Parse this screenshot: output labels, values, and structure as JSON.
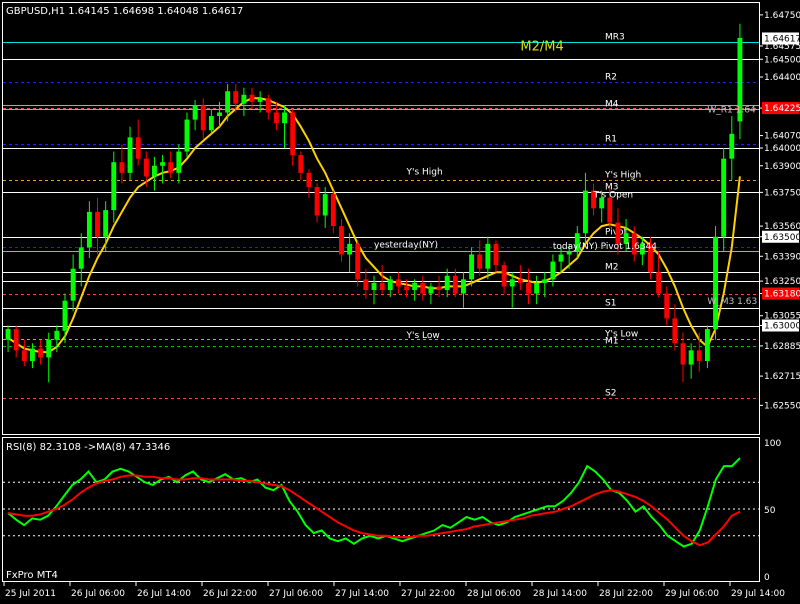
{
  "chart_data": [
    {
      "type": "candlestick",
      "title": "GBPUSD,H1  1.64145 1.64698 1.64048 1.64617",
      "ylim": [
        1.624,
        1.648
      ],
      "x": [
        "25 Jul 2011",
        "26 Jul 06:00",
        "26 Jul 14:00",
        "26 Jul 22:00",
        "27 Jul 06:00",
        "27 Jul 14:00",
        "27 Jul 22:00",
        "28 Jul 06:00",
        "28 Jul 14:00",
        "28 Jul 22:00",
        "29 Jul 06:00",
        "29 Jul 14:00"
      ],
      "price_ticks": [
        "1.64750",
        "1.64575",
        "1.64500",
        "1.64400",
        "1.64225",
        "1.64070",
        "1.64000",
        "1.63900",
        "1.63750",
        "1.63560",
        "1.63500",
        "1.63390",
        "1.63250",
        "1.63180",
        "1.63055",
        "1.63000",
        "1.62885",
        "1.62715",
        "1.62550"
      ],
      "price_ticks_v": [
        1.6475,
        1.64575,
        1.645,
        1.644,
        1.64225,
        1.6407,
        1.64,
        1.639,
        1.6375,
        1.6356,
        1.635,
        1.6339,
        1.6325,
        1.6318,
        1.63055,
        1.63,
        1.62885,
        1.62715,
        1.6255
      ],
      "highlight_ticks": [
        {
          "label": "1.64617",
          "v": 1.64617,
          "bg": "#ffffff",
          "fg": "#000000"
        },
        {
          "label": "1.64225",
          "v": 1.64225,
          "bg": "#ff0000",
          "fg": "#ffffff"
        },
        {
          "label": "1.63500",
          "v": 1.635,
          "bg": "#ffffff",
          "fg": "#000000"
        },
        {
          "label": "1.63180",
          "v": 1.6318,
          "bg": "#ff0000",
          "fg": "#ffffff"
        },
        {
          "label": "1.63000",
          "v": 1.63,
          "bg": "#ffffff",
          "fg": "#000000"
        }
      ],
      "levels": [
        {
          "label": "MR3",
          "v": 1.646,
          "color": "#00e0e0",
          "style": "solid"
        },
        {
          "label": "",
          "v": 1.645,
          "color": "#ffffff",
          "style": "solid"
        },
        {
          "label": "R2",
          "v": 1.6437,
          "color": "#2020ff",
          "style": "dash"
        },
        {
          "label": "",
          "v": 1.6424,
          "color": "#e0a030",
          "style": "solid"
        },
        {
          "label": "M4",
          "v": 1.6422,
          "color": "#e0a030",
          "style": "solid"
        },
        {
          "label": "",
          "v": 1.64225,
          "color": "#ff4040",
          "style": "dash"
        },
        {
          "label": "R1",
          "v": 1.6402,
          "color": "#2020ff",
          "style": "dash"
        },
        {
          "label": "",
          "v": 1.64,
          "color": "#ffffff",
          "style": "solid"
        },
        {
          "label": "Y's High",
          "v": 1.6382,
          "color": "#e0a030",
          "style": "dash"
        },
        {
          "label": "M3",
          "v": 1.6375,
          "color": "#ffffff",
          "style": "solid"
        },
        {
          "label": "Pivot",
          "v": 1.635,
          "color": "#ffffff",
          "style": "solid"
        },
        {
          "label": "",
          "v": 1.63445,
          "color": "#2020ff",
          "style": "dash"
        },
        {
          "label": "",
          "v": 1.6342,
          "color": "#e0a030",
          "style": "solid"
        },
        {
          "label": "M2",
          "v": 1.633,
          "color": "#ffffff",
          "style": "solid"
        },
        {
          "label": "",
          "v": 1.6325,
          "color": "#ffffff",
          "style": "solid"
        },
        {
          "label": "",
          "v": 1.6318,
          "color": "#ff4040",
          "style": "dash"
        },
        {
          "label": "S1",
          "v": 1.631,
          "color": "#ffffff",
          "style": "solid"
        },
        {
          "label": "",
          "v": 1.63,
          "color": "#ffffff",
          "style": "solid"
        },
        {
          "label": "Y's Low",
          "v": 1.62925,
          "color": "#e0a030",
          "style": "dash"
        },
        {
          "label": "M1",
          "v": 1.62885,
          "color": "#00c000",
          "style": "dash"
        },
        {
          "label": "S2",
          "v": 1.6259,
          "color": "#ff4040",
          "style": "dash"
        }
      ],
      "annotations": [
        {
          "text": "M2/M4",
          "t": 63,
          "v": 1.6455,
          "color": "#e0e000",
          "size": "big"
        },
        {
          "text": "Y's High",
          "t": 49,
          "v": 1.6385
        },
        {
          "text": "T's Open",
          "t": 72,
          "v": 1.6372
        },
        {
          "text": "yesterday(NY)",
          "t": 45,
          "v": 1.6344
        },
        {
          "text": "today(NY) Pivot 1.6344",
          "t": 67,
          "v": 1.6343
        },
        {
          "text": "Y's Low",
          "t": 49,
          "v": 1.6293
        },
        {
          "text": "W_R1 1.64",
          "t": 86,
          "v": 1.642,
          "color": "#c0c0c0"
        },
        {
          "text": "W_M3 1.63",
          "t": 86,
          "v": 1.6312,
          "color": "#c0c0c0"
        }
      ],
      "ohlc": [
        [
          1.6292,
          1.63,
          1.6285,
          1.6298
        ],
        [
          1.6298,
          1.63,
          1.6282,
          1.6286
        ],
        [
          1.6286,
          1.6292,
          1.6277,
          1.628
        ],
        [
          1.628,
          1.629,
          1.6276,
          1.6287
        ],
        [
          1.6287,
          1.6292,
          1.6278,
          1.6282
        ],
        [
          1.6282,
          1.6296,
          1.6268,
          1.6292
        ],
        [
          1.6292,
          1.63,
          1.6285,
          1.6297
        ],
        [
          1.6297,
          1.6318,
          1.629,
          1.6314
        ],
        [
          1.6314,
          1.634,
          1.6308,
          1.6332
        ],
        [
          1.6332,
          1.6352,
          1.6322,
          1.6344
        ],
        [
          1.6344,
          1.637,
          1.6338,
          1.6364
        ],
        [
          1.6364,
          1.6372,
          1.634,
          1.635
        ],
        [
          1.635,
          1.637,
          1.6342,
          1.6365
        ],
        [
          1.6365,
          1.6398,
          1.6358,
          1.6392
        ],
        [
          1.6392,
          1.6402,
          1.638,
          1.6386
        ],
        [
          1.6386,
          1.6412,
          1.6382,
          1.6406
        ],
        [
          1.6406,
          1.6416,
          1.639,
          1.6394
        ],
        [
          1.6394,
          1.6398,
          1.6378,
          1.6384
        ],
        [
          1.6384,
          1.6395,
          1.6376,
          1.639
        ],
        [
          1.639,
          1.6396,
          1.638,
          1.6392
        ],
        [
          1.6392,
          1.6398,
          1.6383,
          1.6386
        ],
        [
          1.6386,
          1.6402,
          1.638,
          1.6398
        ],
        [
          1.6398,
          1.642,
          1.6395,
          1.6416
        ],
        [
          1.6416,
          1.6427,
          1.641,
          1.6424
        ],
        [
          1.6424,
          1.6428,
          1.6405,
          1.641
        ],
        [
          1.641,
          1.6422,
          1.6408,
          1.6418
        ],
        [
          1.6418,
          1.6426,
          1.6412,
          1.642
        ],
        [
          1.642,
          1.6436,
          1.6415,
          1.6432
        ],
        [
          1.6432,
          1.6436,
          1.642,
          1.6425
        ],
        [
          1.6425,
          1.6434,
          1.6418,
          1.643
        ],
        [
          1.643,
          1.6434,
          1.6422,
          1.6426
        ],
        [
          1.6426,
          1.6432,
          1.642,
          1.6428
        ],
        [
          1.6428,
          1.643,
          1.6416,
          1.642
        ],
        [
          1.642,
          1.6426,
          1.641,
          1.6414
        ],
        [
          1.6414,
          1.6424,
          1.64,
          1.642
        ],
        [
          1.642,
          1.6422,
          1.639,
          1.6396
        ],
        [
          1.6396,
          1.6398,
          1.6382,
          1.6386
        ],
        [
          1.6386,
          1.6388,
          1.6372,
          1.6378
        ],
        [
          1.6378,
          1.638,
          1.6358,
          1.6362
        ],
        [
          1.6362,
          1.6378,
          1.6355,
          1.6374
        ],
        [
          1.6374,
          1.6376,
          1.6352,
          1.6356
        ],
        [
          1.6356,
          1.636,
          1.6336,
          1.634
        ],
        [
          1.634,
          1.6352,
          1.633,
          1.6346
        ],
        [
          1.6346,
          1.6348,
          1.6322,
          1.6326
        ],
        [
          1.6326,
          1.6332,
          1.6315,
          1.632
        ],
        [
          1.632,
          1.6328,
          1.6312,
          1.6324
        ],
        [
          1.6324,
          1.6334,
          1.6318,
          1.632
        ],
        [
          1.632,
          1.6328,
          1.6316,
          1.6326
        ],
        [
          1.6326,
          1.633,
          1.6318,
          1.6322
        ],
        [
          1.6322,
          1.6326,
          1.6316,
          1.632
        ],
        [
          1.632,
          1.6326,
          1.6314,
          1.6324
        ],
        [
          1.6324,
          1.6328,
          1.6314,
          1.6318
        ],
        [
          1.6318,
          1.6324,
          1.6312,
          1.6322
        ],
        [
          1.6322,
          1.6328,
          1.6316,
          1.632
        ],
        [
          1.632,
          1.6332,
          1.6316,
          1.6328
        ],
        [
          1.6328,
          1.6332,
          1.6316,
          1.6318
        ],
        [
          1.6318,
          1.633,
          1.631,
          1.6326
        ],
        [
          1.6326,
          1.6344,
          1.6322,
          1.634
        ],
        [
          1.634,
          1.6348,
          1.6328,
          1.6332
        ],
        [
          1.6332,
          1.635,
          1.6326,
          1.6346
        ],
        [
          1.6346,
          1.6348,
          1.633,
          1.6334
        ],
        [
          1.6334,
          1.6336,
          1.6318,
          1.6322
        ],
        [
          1.6322,
          1.633,
          1.631,
          1.6326
        ],
        [
          1.6326,
          1.6334,
          1.632,
          1.6324
        ],
        [
          1.6324,
          1.6332,
          1.6312,
          1.6318
        ],
        [
          1.6318,
          1.6328,
          1.6312,
          1.6324
        ],
        [
          1.6324,
          1.633,
          1.6316,
          1.6326
        ],
        [
          1.6326,
          1.634,
          1.6322,
          1.6336
        ],
        [
          1.6336,
          1.6344,
          1.633,
          1.634
        ],
        [
          1.634,
          1.6346,
          1.6332,
          1.6342
        ],
        [
          1.6342,
          1.6356,
          1.6338,
          1.6352
        ],
        [
          1.6352,
          1.6386,
          1.6346,
          1.6376
        ],
        [
          1.6376,
          1.638,
          1.6362,
          1.6366
        ],
        [
          1.6366,
          1.6376,
          1.6358,
          1.6372
        ],
        [
          1.6372,
          1.6378,
          1.6355,
          1.6358
        ],
        [
          1.6358,
          1.6366,
          1.634,
          1.6346
        ],
        [
          1.6346,
          1.636,
          1.6342,
          1.6352
        ],
        [
          1.6352,
          1.6356,
          1.6336,
          1.634
        ],
        [
          1.634,
          1.635,
          1.6334,
          1.6346
        ],
        [
          1.6346,
          1.635,
          1.6326,
          1.633
        ],
        [
          1.633,
          1.6342,
          1.6316,
          1.6318
        ],
        [
          1.6318,
          1.6322,
          1.63,
          1.6304
        ],
        [
          1.6304,
          1.6312,
          1.6286,
          1.629
        ],
        [
          1.629,
          1.6296,
          1.6268,
          1.6278
        ],
        [
          1.6278,
          1.629,
          1.627,
          1.6286
        ],
        [
          1.6286,
          1.6296,
          1.6274,
          1.628
        ],
        [
          1.628,
          1.63,
          1.6276,
          1.6298
        ],
        [
          1.6298,
          1.6356,
          1.6292,
          1.635
        ],
        [
          1.635,
          1.64,
          1.6342,
          1.6394
        ],
        [
          1.6394,
          1.6418,
          1.6382,
          1.6408
        ],
        [
          1.6415,
          1.647,
          1.6405,
          1.6462
        ]
      ],
      "ma_values": [
        1.6293,
        1.629,
        1.6287,
        1.6286,
        1.6285,
        1.6285,
        1.6288,
        1.6294,
        1.6304,
        1.6316,
        1.6328,
        1.6338,
        1.6346,
        1.6356,
        1.6364,
        1.6372,
        1.6378,
        1.6381,
        1.6384,
        1.6386,
        1.6387,
        1.6389,
        1.6394,
        1.64,
        1.6404,
        1.6408,
        1.6412,
        1.6418,
        1.6422,
        1.6426,
        1.6428,
        1.6428,
        1.6427,
        1.6425,
        1.6423,
        1.6419,
        1.6412,
        1.6404,
        1.6394,
        1.6386,
        1.6376,
        1.6366,
        1.6356,
        1.6346,
        1.6338,
        1.6333,
        1.6328,
        1.6325,
        1.6324,
        1.6323,
        1.6322,
        1.6322,
        1.6321,
        1.6321,
        1.6322,
        1.6322,
        1.6322,
        1.6324,
        1.6326,
        1.6328,
        1.633,
        1.633,
        1.6328,
        1.6326,
        1.6325,
        1.6324,
        1.6325,
        1.6327,
        1.633,
        1.6334,
        1.6338,
        1.6346,
        1.6352,
        1.6356,
        1.6357,
        1.6356,
        1.6355,
        1.6352,
        1.6349,
        1.6345,
        1.634,
        1.6332,
        1.6322,
        1.631,
        1.63,
        1.6292,
        1.6288,
        1.6298,
        1.6318,
        1.6344,
        1.6384
      ],
      "ma_color": "#ffd000"
    },
    {
      "type": "line",
      "title": "RSI(8) 82.3108  ->MA(8) 47.3346",
      "ylim": [
        0,
        100
      ],
      "y_ticks": [
        "100",
        "50",
        "0"
      ],
      "y_ticks_v": [
        100,
        50,
        0
      ],
      "dotted_levels": [
        70,
        50,
        30
      ],
      "series": [
        {
          "color": "#00ff00",
          "values": [
            47,
            42,
            38,
            43,
            42,
            45,
            52,
            60,
            68,
            72,
            78,
            70,
            72,
            78,
            80,
            78,
            74,
            70,
            68,
            72,
            74,
            70,
            75,
            78,
            72,
            70,
            73,
            76,
            72,
            73,
            70,
            72,
            66,
            64,
            68,
            56,
            48,
            38,
            32,
            34,
            28,
            26,
            28,
            24,
            28,
            30,
            28,
            30,
            28,
            26,
            28,
            30,
            32,
            34,
            38,
            36,
            40,
            44,
            42,
            44,
            40,
            38,
            40,
            44,
            46,
            48,
            50,
            52,
            52,
            56,
            62,
            70,
            82,
            78,
            72,
            64,
            62,
            56,
            48,
            52,
            44,
            38,
            30,
            26,
            22,
            24,
            34,
            52,
            72,
            82,
            82,
            88
          ]
        },
        {
          "color": "#ff0000",
          "values": [
            47,
            46,
            45,
            45,
            46,
            48,
            50,
            53,
            57,
            62,
            66,
            69,
            71,
            72,
            74,
            75,
            75,
            74,
            74,
            73,
            73,
            72,
            72,
            73,
            73,
            72,
            72,
            72,
            72,
            71,
            71,
            70,
            69,
            68,
            67,
            64,
            60,
            56,
            52,
            48,
            44,
            40,
            37,
            34,
            32,
            31,
            30,
            30,
            29,
            29,
            29,
            30,
            30,
            31,
            32,
            33,
            34,
            35,
            37,
            38,
            39,
            40,
            41,
            42,
            43,
            45,
            46,
            47,
            48,
            50,
            52,
            55,
            58,
            61,
            63,
            64,
            63,
            61,
            59,
            56,
            52,
            47,
            42,
            36,
            30,
            26,
            23,
            25,
            31,
            37,
            45,
            48
          ]
        }
      ]
    }
  ],
  "footer": {
    "label": "FxPro MT4"
  },
  "colors": {
    "bg": "#000000",
    "bull": "#00ff00",
    "bear": "#ff0000",
    "axis": "#ffffff",
    "grid_dot": "#ffffff"
  }
}
